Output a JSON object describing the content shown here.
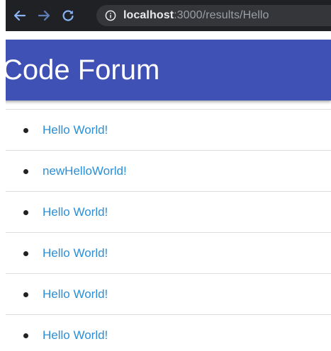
{
  "browser": {
    "url_host": "localhost",
    "url_rest": ":3000/results/Hello",
    "icon_color": "#8ab4f8"
  },
  "app": {
    "title": "Code Forum",
    "header_color": "#3f51b5"
  },
  "results": {
    "items": [
      {
        "label": "Hello World!"
      },
      {
        "label": "newHelloWorld!"
      },
      {
        "label": "Hello World!"
      },
      {
        "label": "Hello World!"
      },
      {
        "label": "Hello World!"
      },
      {
        "label": "Hello World!"
      }
    ]
  }
}
